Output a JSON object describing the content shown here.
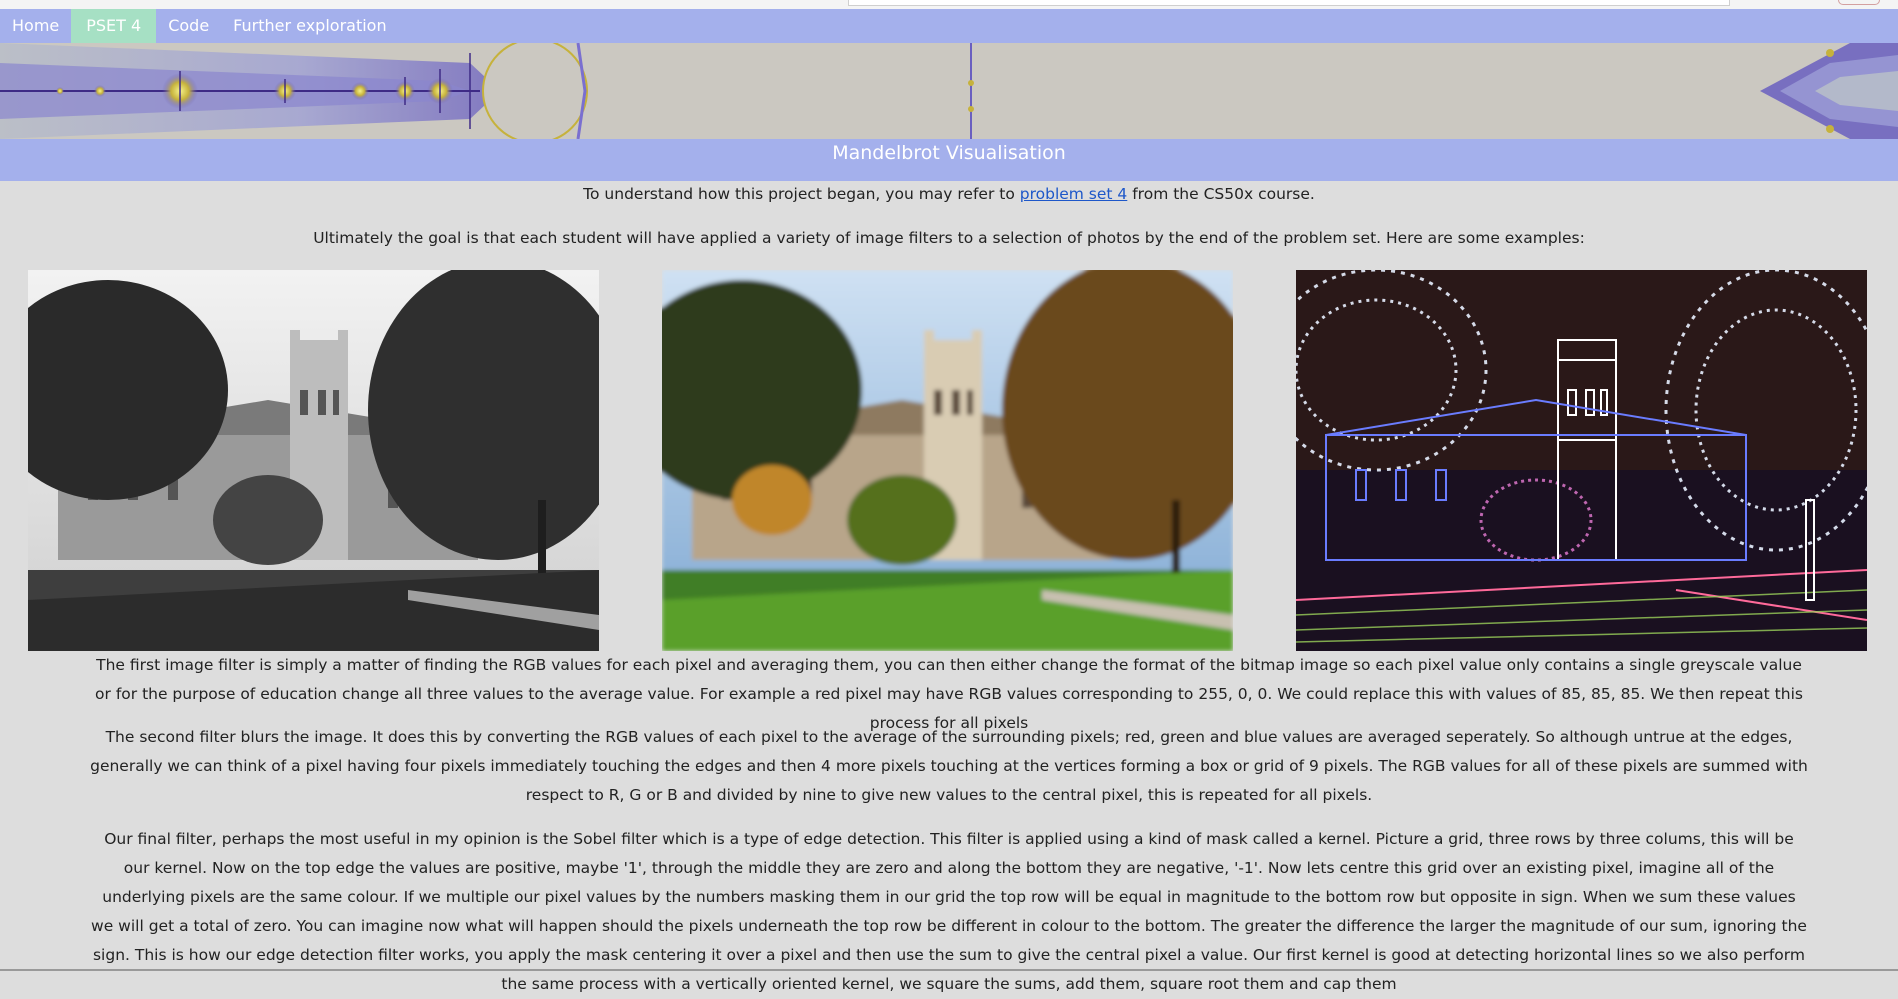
{
  "nav": {
    "items": [
      {
        "label": "Home"
      },
      {
        "label": "PSET 4"
      },
      {
        "label": "Code"
      },
      {
        "label": "Further exploration"
      }
    ]
  },
  "header": {
    "title": "Mandelbrot Visualisation"
  },
  "intro": {
    "before_link": "To understand how this project began, you may refer to ",
    "link_text": "problem set 4",
    "after_link": " from the CS50x course.",
    "goal": "Ultimately the goal is that each student will have applied a variety of image filters to a selection of photos by the end of the problem set. Here are some examples:"
  },
  "images": [
    {
      "name": "greyscale-photo"
    },
    {
      "name": "blurred-photo"
    },
    {
      "name": "edge-detected-photo"
    }
  ],
  "body": {
    "para1": "The first image filter is simply a matter of finding the RGB values for each pixel and averaging them, you can then either change the format of the bitmap image so each pixel value only contains a single greyscale value or for the purpose of education change all three values to the average value. For example a red pixel may have RGB values corresponding to 255, 0, 0. We could replace this with values of 85, 85, 85. We then repeat this process for all pixels",
    "para2": "The second filter blurs the image. It does this by converting the RGB values of each pixel to the average of the surrounding pixels; red, green and blue values are averaged seperately. So although untrue at the edges, generally we can think of a pixel having four pixels immediately touching the edges and then 4 more pixels touching at the vertices forming a box or grid of 9 pixels. The RGB values for all of these pixels are summed with respect to R, G or B and divided by nine to give new values to the central pixel, this is repeated for all pixels.",
    "para3": "Our final filter, perhaps the most useful in my opinion is the Sobel filter which is a type of edge detection. This filter is applied using a kind of mask called a kernel. Picture a grid, three rows by three colums, this will be our kernel. Now on the top edge the values are positive, maybe '1', through the middle they are zero and along the bottom they are negative, '-1'. Now lets centre this grid over an existing pixel, imagine all of the underlying pixels are the same colour. If we multiple our pixel values by the numbers masking them in our grid the top row will be equal in magnitude to the bottom row but opposite in sign. When we sum these values we will get a total of zero. You can imagine now what will happen should the pixels underneath the top row be different in colour to the bottom. The greater the difference the larger the magnitude of our sum, ignoring the sign. This is how our edge detection filter works, you apply the mask centering it over a pixel and then use the sum to give the central pixel a value. Our first kernel is good at detecting horizontal lines so we also perform the same process with a vertically oriented kernel, we square the sums, add them, square root them and cap them"
  },
  "colors": {
    "nav_bg": "#a4b0ec",
    "nav_active": "#a6e0c4",
    "page_bg": "#dddddd",
    "link": "#1d57c9"
  }
}
